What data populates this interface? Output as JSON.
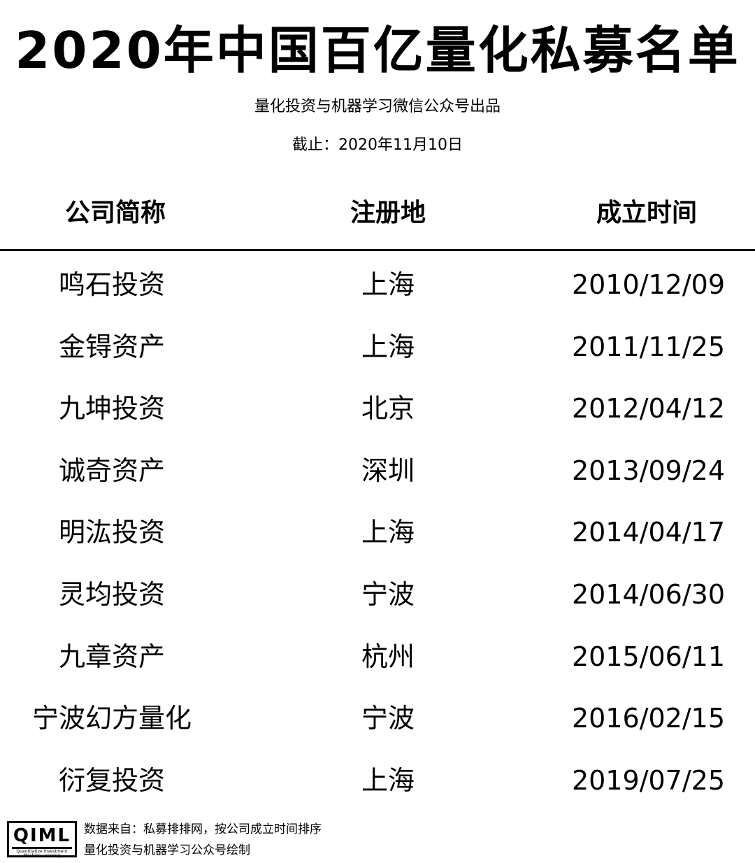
{
  "title": "2020年中国百亿量化私募名单",
  "subtitle": "量化投资与机器学习微信公众号出品",
  "as_of": "截止：2020年11月10日",
  "table": {
    "headers": [
      "公司简称",
      "注册地",
      "成立时间"
    ],
    "rows": [
      [
        "鸣石投资",
        "上海",
        "2010/12/09"
      ],
      [
        "金锝资产",
        "上海",
        "2011/11/25"
      ],
      [
        "九坤投资",
        "北京",
        "2012/04/12"
      ],
      [
        "诚奇资产",
        "深圳",
        "2013/09/24"
      ],
      [
        "明汯投资",
        "上海",
        "2014/04/17"
      ],
      [
        "灵均投资",
        "宁波",
        "2014/06/30"
      ],
      [
        "九章资产",
        "杭州",
        "2015/06/11"
      ],
      [
        "宁波幻方量化",
        "宁波",
        "2016/02/15"
      ],
      [
        "衍复投资",
        "上海",
        "2019/07/25"
      ]
    ]
  },
  "footer": {
    "logo_mark": "QIML",
    "logo_tiny_1": "Quantitative Investment",
    "logo_tiny_2": "Machine Learning",
    "source_line": "数据来自：私募排排网，按公司成立时间排序",
    "credit_line": "量化投资与机器学习公众号绘制"
  }
}
